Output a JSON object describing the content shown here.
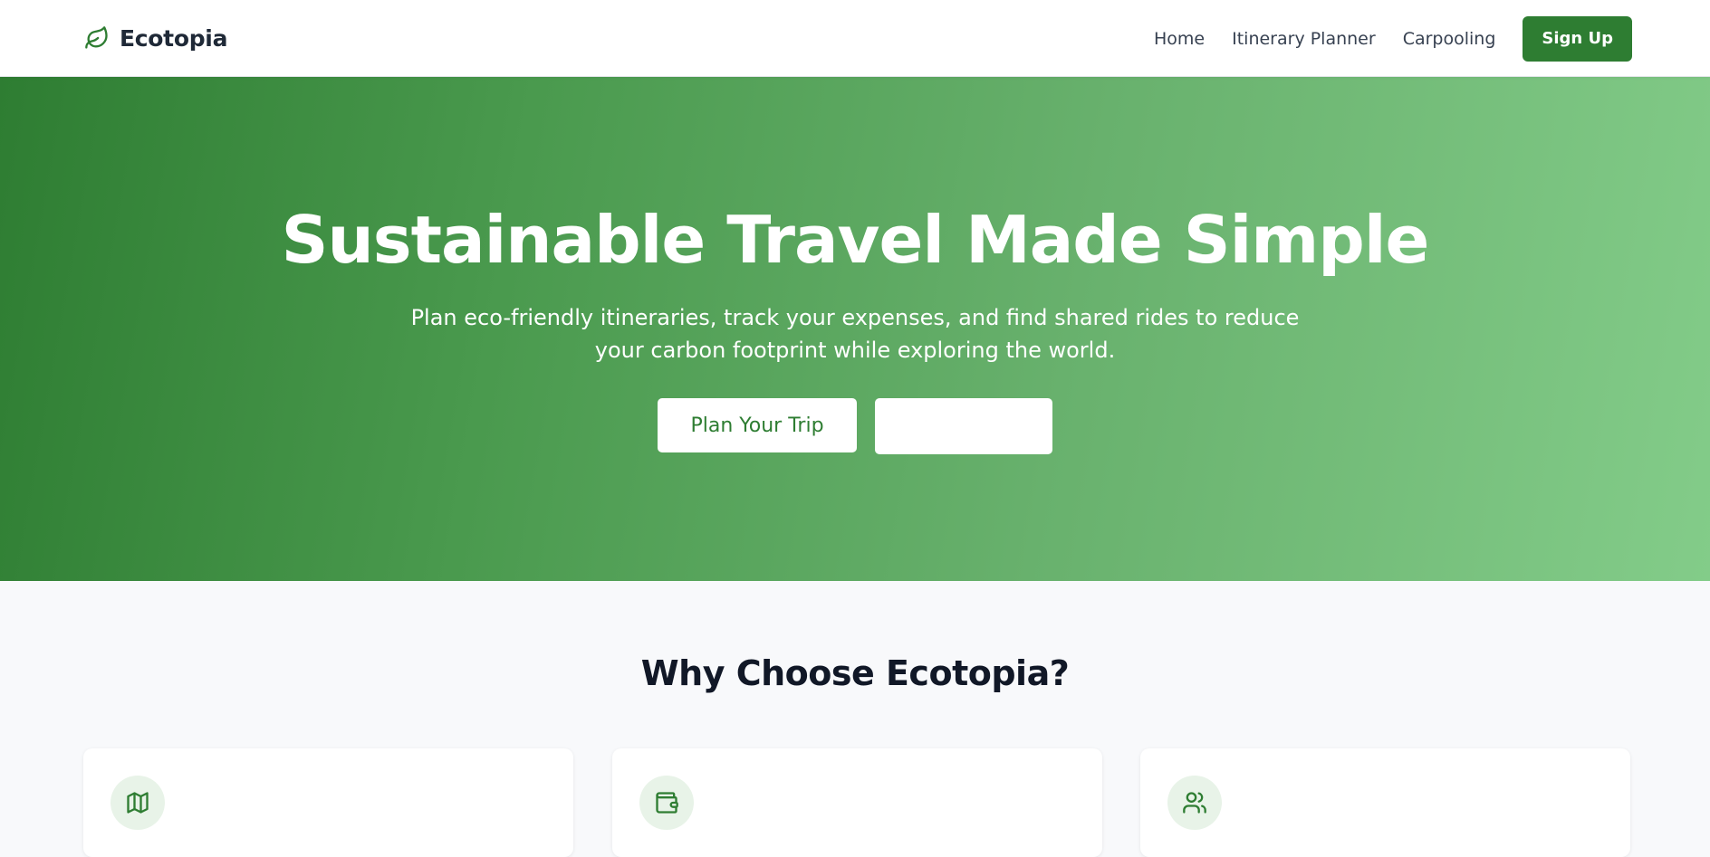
{
  "brand": {
    "name": "Ecotopia",
    "icon": "leaf-icon",
    "color": "#2e7d32"
  },
  "nav": {
    "links": [
      "Home",
      "Itinerary Planner",
      "Carpooling"
    ],
    "signup_label": "Sign Up"
  },
  "hero": {
    "title": "Sustainable Travel Made Simple",
    "subtitle": "Plan eco-friendly itineraries, track your expenses, and find shared rides to reduce your carbon footprint while exploring the world.",
    "primary_button": "Plan Your Trip",
    "secondary_button": "",
    "gradient_start": "#2e7d32",
    "gradient_end": "#83cc89"
  },
  "features": {
    "title": "Why Choose Ecotopia?",
    "cards": [
      {
        "icon": "map-icon"
      },
      {
        "icon": "wallet-icon"
      },
      {
        "icon": "users-icon"
      }
    ]
  },
  "colors": {
    "accent": "#2e7d32",
    "icon_bg": "#e8f3e8",
    "page_bg": "#f8f9fb"
  }
}
